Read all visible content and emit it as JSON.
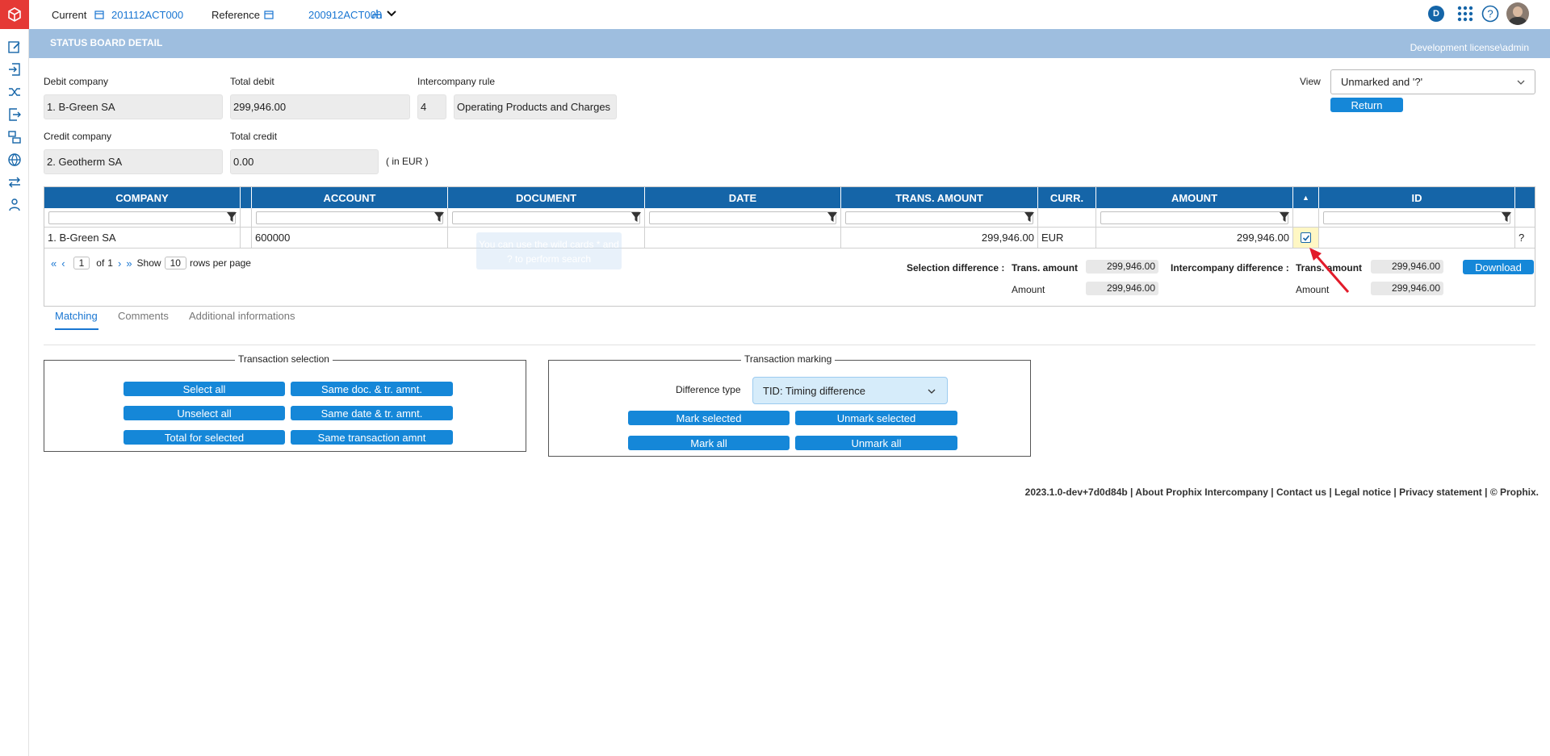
{
  "topbar": {
    "current_label": "Current",
    "current_value": "201112ACT000",
    "reference_label": "Reference",
    "reference_value": "200912ACT000",
    "user_badge": "D"
  },
  "banner": {
    "title": "STATUS BOARD DETAIL",
    "license": "Development license\\admin"
  },
  "form": {
    "debit_company_label": "Debit company",
    "debit_company_value": "1. B-Green SA",
    "total_debit_label": "Total debit",
    "total_debit_value": "299,946.00",
    "ic_rule_label": "Intercompany rule",
    "ic_rule_number": "4",
    "ic_rule_name": "Operating Products and Charges",
    "credit_company_label": "Credit company",
    "credit_company_value": "2. Geotherm SA",
    "total_credit_label": "Total credit",
    "total_credit_value": "0.00",
    "currency_note": "( in EUR )",
    "view_label": "View",
    "view_value": "Unmarked and '?'",
    "return_label": "Return"
  },
  "grid": {
    "headers": {
      "company": "COMPANY",
      "account": "ACCOUNT",
      "document": "DOCUMENT",
      "date": "DATE",
      "trans_amount": "TRANS. AMOUNT",
      "curr": "CURR.",
      "amount": "AMOUNT",
      "sort": "▲",
      "id": "ID"
    },
    "row": {
      "company": "1. B-Green SA",
      "account": "600000",
      "trans_amount": "299,946.00",
      "curr": "EUR",
      "amount": "299,946.00",
      "id_flag": "?"
    },
    "tooltip": "You can use the wild cards * and ? to perform search",
    "pager": {
      "page": "1",
      "of_label": "of",
      "total_pages": "1",
      "show_label": "Show",
      "rows": "10",
      "rows_label": "rows per page"
    },
    "summary": {
      "selection_diff_label": "Selection difference :",
      "ic_diff_label": "Intercompany difference :",
      "trans_amount_label": "Trans. amount",
      "amount_label": "Amount",
      "sel_trans_amount": "299,946.00",
      "sel_amount": "299,946.00",
      "ic_trans_amount": "299,946.00",
      "ic_amount": "299,946.00",
      "download_label": "Download"
    }
  },
  "tabs": [
    {
      "label": "Matching"
    },
    {
      "label": "Comments"
    },
    {
      "label": "Additional informations"
    }
  ],
  "transaction_selection": {
    "legend": "Transaction selection",
    "select_all": "Select all",
    "same_doc": "Same doc. & tr. amnt.",
    "unselect_all": "Unselect all",
    "same_date": "Same date & tr. amnt.",
    "total_selected": "Total for selected",
    "same_trans": "Same transaction amnt"
  },
  "transaction_marking": {
    "legend": "Transaction marking",
    "diff_type_label": "Difference type",
    "diff_type_value": "TID: Timing difference",
    "mark_selected": "Mark selected",
    "unmark_selected": "Unmark selected",
    "mark_all": "Mark all",
    "unmark_all": "Unmark all"
  },
  "footer": "2023.1.0-dev+7d0d84b | About Prophix Intercompany | Contact us | Legal notice | Privacy statement | © Prophix.",
  "colors": {
    "accent": "#1587d8",
    "header": "#1565a8",
    "banner": "#9ebedf",
    "logo": "#e53935"
  }
}
